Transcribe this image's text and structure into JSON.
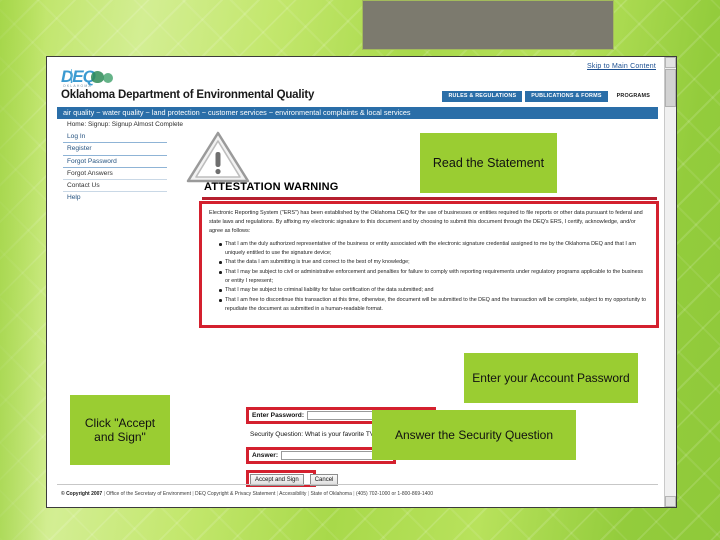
{
  "slide": {
    "accent_green": "#9acd32",
    "red_highlight": "#d4202e",
    "nav_blue": "#2a6ea8"
  },
  "browser": {
    "skip_link": "Skip to Main Content"
  },
  "site_header": {
    "logo_text": "DEQ",
    "logo_subtext": "OKLAHOMA",
    "title": "Oklahoma Department of Environmental Quality",
    "tabs": [
      "RULES & REGULATIONS",
      "PUBLICATIONS & FORMS",
      "PROGRAMS"
    ],
    "nav_bar": "air quality ~ water quality ~ land protection ~ customer services ~ environmental complaints & local services",
    "breadcrumb": "Home:  Signup:  Signup Almost Complete"
  },
  "sidebar": {
    "items": [
      {
        "label": "Log In"
      },
      {
        "label": "Register"
      },
      {
        "label": "Forgot Password"
      },
      {
        "label": "Forgot Answers"
      },
      {
        "label": "Contact Us"
      },
      {
        "label": "Help"
      }
    ]
  },
  "attestation": {
    "heading": "ATTESTATION WARNING",
    "paragraph": "Electronic Reporting System (\"ERS\") has been established by the Oklahoma DEQ for the use of businesses or entities required to file reports or other data pursuant to federal and state laws and regulations. By affixing my electronic signature to this document and by choosing to submit this document through the DEQ's ERS, I certify, acknowledge, and/or agree as follows:",
    "bullets": [
      "That I am the duly authorized representative of the business or entity associated with the electronic signature credential assigned to me by the Oklahoma DEQ and that I am uniquely entitled to use the signature device;",
      "That the data I am submitting is true and correct to the best of my knowledge;",
      "That I may be subject to civil or administrative enforcement and penalties for failure to comply with reporting requirements under regulatory programs applicable to the business or entity I represent;",
      "That I may be subject to criminal liability for false certification of the data submitted; and",
      "That I am free to discontinue this transaction at this time, otherwise, the document will be submitted to the DEQ and the transaction will be complete, subject to my opportunity to repudiate the document as submitted in a human-readable format."
    ]
  },
  "form": {
    "password_label": "Enter Password:",
    "password_value": "",
    "password_placeholder": "",
    "security_question": "Security Question: What is your favorite TV show?",
    "answer_label": "Answer:",
    "answer_value": "",
    "answer_placeholder": "",
    "accept_button": "Accept and Sign",
    "cancel_button": "Cancel"
  },
  "callouts": {
    "read_statement": "Read the Statement",
    "enter_password": "Enter your Account Password",
    "answer_question": "Answer the Security Question",
    "click_accept": "Click \"Accept and Sign\""
  },
  "footer": {
    "copyright": "© Copyright 2007",
    "links": [
      "Office of the Secretary of Environment",
      "DEQ Copyright & Privacy Statement",
      "Accessibility",
      "State of Oklahoma"
    ],
    "phone": "(405) 702-1000 or 1-800-869-1400"
  }
}
